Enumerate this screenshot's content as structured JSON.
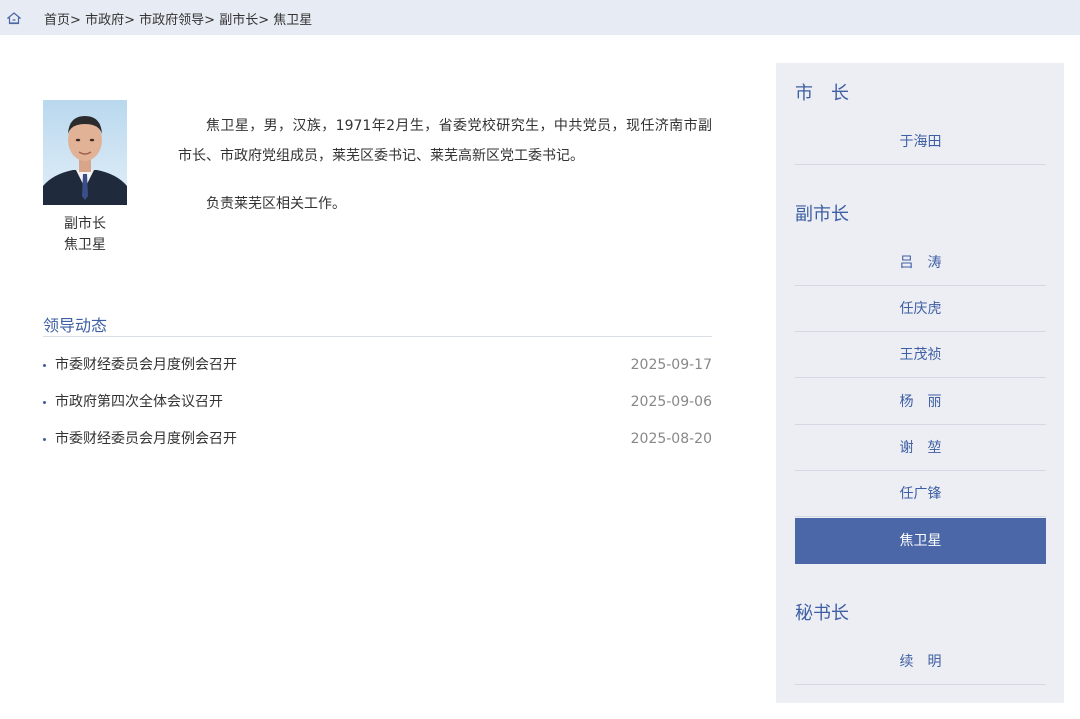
{
  "breadcrumb": {
    "items": [
      "首页",
      "市政府",
      "市政府领导",
      "副市长",
      "焦卫星"
    ],
    "separator": ">"
  },
  "profile": {
    "title": "副市长",
    "name": "焦卫星",
    "bio": [
      "焦卫星，男，汉族，1971年2月生，省委党校研究生，中共党员，现任济南市副市长、市政府党组成员，莱芜区委书记、莱芜高新区党工委书记。",
      "负责莱芜区相关工作。"
    ]
  },
  "news": {
    "title": "领导动态",
    "items": [
      {
        "title": "市委财经委员会月度例会召开",
        "date": "2025-09-17"
      },
      {
        "title": "市政府第四次全体会议召开",
        "date": "2025-09-06"
      },
      {
        "title": "市委财经委员会月度例会召开",
        "date": "2025-08-20"
      }
    ]
  },
  "sidebar": {
    "groups": [
      {
        "title": "市　长",
        "items": [
          "于海田"
        ]
      },
      {
        "title": "副市长",
        "items": [
          "吕　涛",
          "任庆虎",
          "王茂祯",
          "杨　丽",
          "谢　堃",
          "任广锋",
          "焦卫星"
        ]
      },
      {
        "title": "秘书长",
        "items": [
          "续　明"
        ]
      }
    ],
    "active": "焦卫星"
  },
  "colors": {
    "accent": "#3e5fa3",
    "active_bg": "#4c67a8",
    "breadcrumb_bg": "#e7ebf3",
    "sidebar_bg": "#eceef4"
  },
  "icons": {
    "home": "home-icon",
    "bullet": "bullet-dot"
  }
}
